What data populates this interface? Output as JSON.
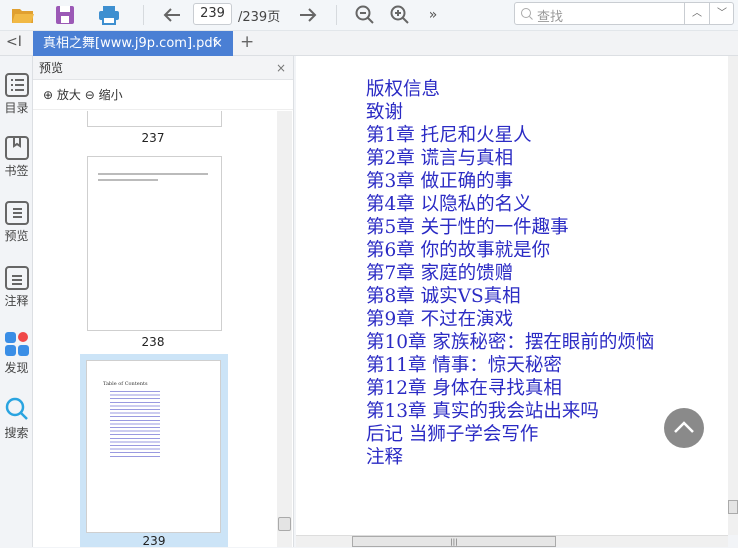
{
  "toolbar": {
    "page_current": "239",
    "page_total": "/239页",
    "more": "»",
    "search_placeholder": "查找"
  },
  "tabs": [
    {
      "label": "真相之舞[www.j9p.com].pdf",
      "close": "×"
    }
  ],
  "tab_add": "+",
  "collapse": "<I",
  "rail": [
    {
      "label": "目录"
    },
    {
      "label": "书签"
    },
    {
      "label": "预览"
    },
    {
      "label": "注释"
    },
    {
      "label": "发现"
    },
    {
      "label": "搜索"
    }
  ],
  "panel": {
    "title": "预览",
    "close": "×",
    "zoom_in": "放大",
    "zoom_out": "缩小",
    "pages": [
      "237",
      "238",
      "239"
    ],
    "thumb_title": "Table of Contents"
  },
  "toc": [
    "版权信息",
    "致谢",
    "第1章  托尼和火星人",
    "第2章  谎言与真相",
    "第3章  做正确的事",
    "第4章  以隐私的名义",
    "第5章  关于性的一件趣事",
    "第6章  你的故事就是你",
    "第7章  家庭的馈赠",
    "第8章  诚实VS真相",
    "第9章  不过在演戏",
    "第10章  家族秘密：摆在眼前的烦恼",
    "第11章  情事：惊天秘密",
    "第12章  身体在寻找真相",
    "第13章  真实的我会站出来吗",
    "后记  当狮子学会写作",
    "注释"
  ],
  "colors": {
    "accent": "#4a7fd4",
    "toc_text": "#2b2bc4"
  }
}
